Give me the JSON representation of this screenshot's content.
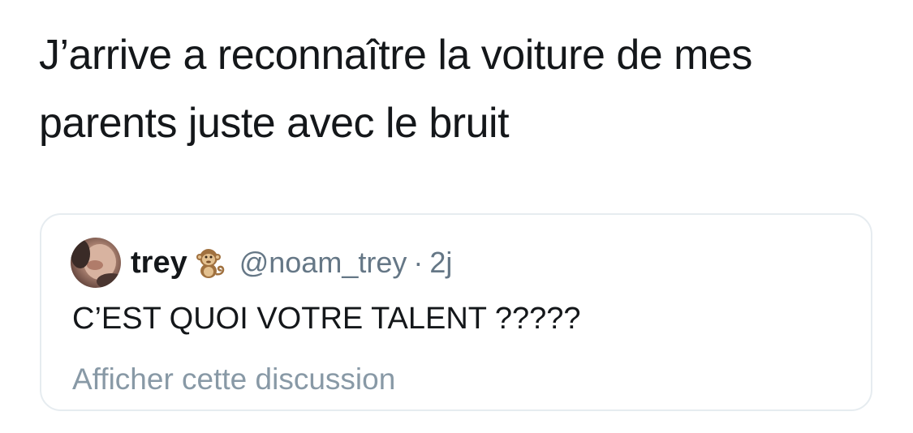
{
  "tweet": {
    "text": "J’arrive a reconnaître la voiture de mes parents juste avec le bruit"
  },
  "quoted_tweet": {
    "display_name": "trey",
    "emoji": "monkey-emoji-icon",
    "handle": "@noam_trey",
    "separator": "·",
    "time": "2j",
    "text": "C’EST QUOI VOTRE TALENT ?????",
    "show_thread": "Afficher cette discussion"
  },
  "colors": {
    "text": "#14171a",
    "secondary": "#657786",
    "link_muted": "#8899a6",
    "border": "#e6ecf0"
  }
}
